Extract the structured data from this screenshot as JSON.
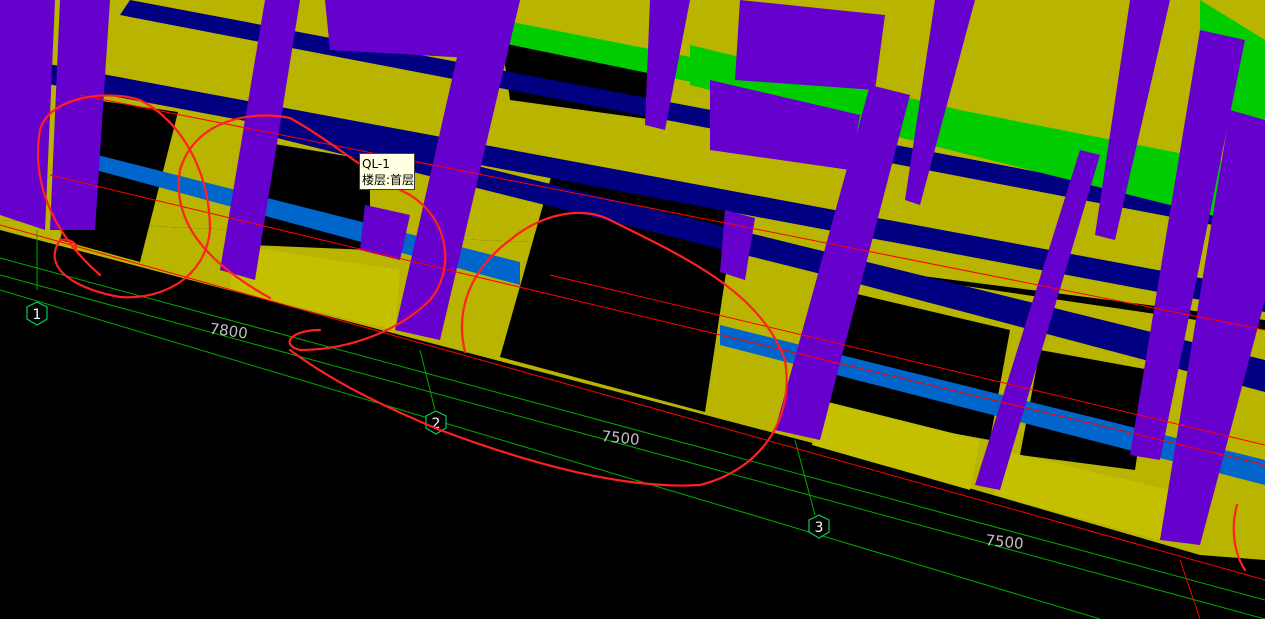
{
  "colors": {
    "background": "#000000",
    "wall": "#B8B400",
    "column": "#6600CC",
    "beam_green": "#00CC00",
    "beam_navy": "#000080",
    "slab_blue": "#0066CC",
    "grid_line": "#00AA00",
    "dim_line": "#FF0000",
    "annotation": "#FF2020"
  },
  "axes": {
    "a1": "1",
    "a2": "2",
    "a3": "3"
  },
  "dimensions": {
    "d1": "7800",
    "d2": "7500",
    "d3": "7500"
  },
  "tooltip": {
    "line1": "QL-1",
    "line2": "楼层:首层"
  }
}
